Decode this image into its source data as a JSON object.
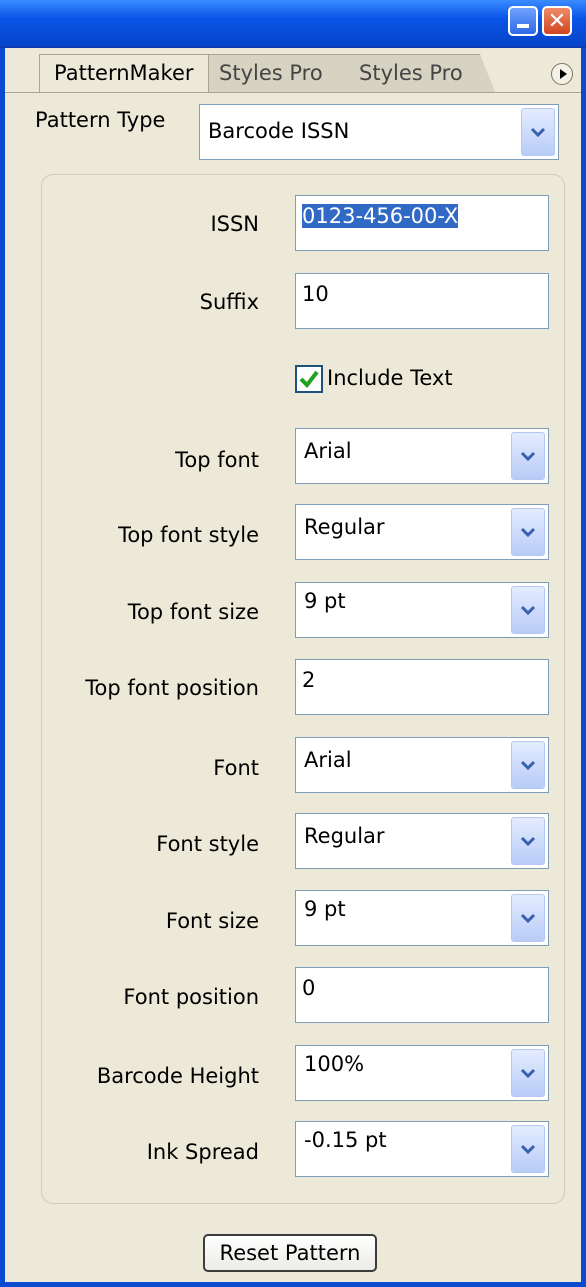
{
  "titlebar": {
    "minimize_icon": "minimize-icon",
    "close_icon": "close-icon",
    "close_glyph": "✕"
  },
  "tabs": [
    {
      "label": "PatternMaker",
      "active": true
    },
    {
      "label": "Styles Pro",
      "active": false
    },
    {
      "label": "Styles Pro",
      "active": false
    }
  ],
  "pattern_type": {
    "label": "Pattern Type",
    "value": "Barcode ISSN"
  },
  "fields": {
    "issn": {
      "label": "ISSN",
      "value": "0123-456-00-X"
    },
    "suffix": {
      "label": "Suffix",
      "value": "10"
    },
    "include_text": {
      "label": "Include Text",
      "checked": true
    },
    "top_font": {
      "label": "Top font",
      "value": "Arial"
    },
    "top_font_style": {
      "label": "Top font style",
      "value": "Regular"
    },
    "top_font_size": {
      "label": "Top font size",
      "value": "9 pt"
    },
    "top_font_position": {
      "label": "Top font position",
      "value": "2"
    },
    "font": {
      "label": "Font",
      "value": "Arial"
    },
    "font_style": {
      "label": "Font style",
      "value": "Regular"
    },
    "font_size": {
      "label": "Font size",
      "value": "9 pt"
    },
    "font_position": {
      "label": "Font position",
      "value": "0"
    },
    "barcode_height": {
      "label": "Barcode Height",
      "value": "100%"
    },
    "ink_spread": {
      "label": "Ink Spread",
      "value": "-0.15 pt"
    }
  },
  "reset_button": {
    "label": "Reset Pattern"
  },
  "colors": {
    "title_bar": "#0A55E8",
    "panel_bg": "#ECE9D8",
    "selection": "#316AC5"
  }
}
